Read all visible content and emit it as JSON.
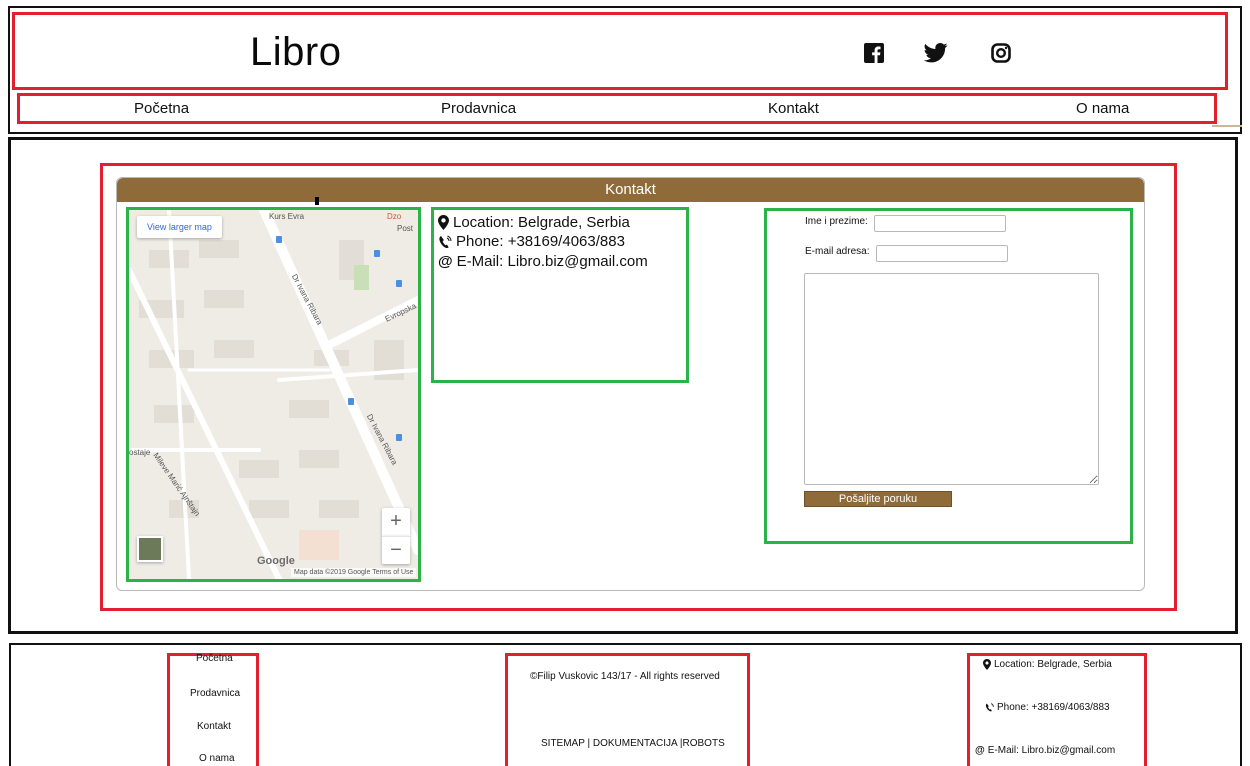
{
  "header": {
    "logo": "Libro",
    "social": [
      {
        "name": "facebook-icon"
      },
      {
        "name": "twitter-icon"
      },
      {
        "name": "instagram-icon"
      }
    ]
  },
  "nav": {
    "items": [
      {
        "label": "Početna"
      },
      {
        "label": "Prodavnica"
      },
      {
        "label": "Kontakt"
      },
      {
        "label": "O nama"
      }
    ]
  },
  "contact": {
    "title": "Kontakt",
    "map": {
      "view_larger": "View larger map",
      "zoom_in": "+",
      "zoom_out": "−",
      "logo": "Google",
      "attribution": "Map data ©2019 Google  Terms of Use",
      "labels": {
        "street1": "Dr Ivana Ribara",
        "street2": "Dr Ivana Ribara",
        "street3": "Evropska",
        "street4": "Mileve Marić Ajnštajn",
        "poi1": "Kurs Evra",
        "poi2": "Dzo",
        "poi3": "Post",
        "poi4": "ostaje"
      }
    },
    "info": {
      "location": "Location: Belgrade, Serbia",
      "phone": "Phone: +38169/4063/883",
      "email": "E-Mail: Libro.biz@gmail.com"
    },
    "form": {
      "name_label": "Ime i prezime:",
      "email_label": "E-mail adresa:",
      "name_value": "",
      "email_value": "",
      "message_value": "",
      "submit_label": "Pošaljite poruku"
    }
  },
  "footer": {
    "nav": [
      {
        "label": "Početna"
      },
      {
        "label": "Prodavnica"
      },
      {
        "label": "Kontakt"
      },
      {
        "label": "O nama"
      }
    ],
    "copyright": "©Filip Vuskovic 143/17 - All rights reserved",
    "links": "SITEMAP | DOKUMENTACIJA |ROBOTS",
    "info": {
      "location": "Location: Belgrade, Serbia",
      "phone": "Phone: +38169/4063/883",
      "email": "E-Mail: Libro.biz@gmail.com"
    }
  },
  "colors": {
    "brand_brown": "#8f6b3a",
    "outline_red": "#e1202f",
    "outline_green": "#2bb34a"
  }
}
